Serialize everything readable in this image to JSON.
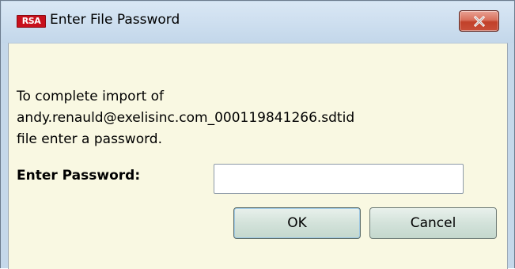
{
  "window": {
    "title": "Enter File Password",
    "logo_text": "RSA",
    "close_icon": "close-icon"
  },
  "message": {
    "line1": "To complete import of",
    "line2": "andy.renauld@exelisinc.com_000119841266.sdtid",
    "line3": "file enter a password."
  },
  "password": {
    "label": "Enter Password:",
    "value": ""
  },
  "buttons": {
    "ok_label": "OK",
    "cancel_label": "Cancel"
  },
  "colors": {
    "client_background": "#f9f8e2",
    "titlebar": "#c5d8ea",
    "close_button": "#c84e38",
    "logo": "#c8101c"
  }
}
